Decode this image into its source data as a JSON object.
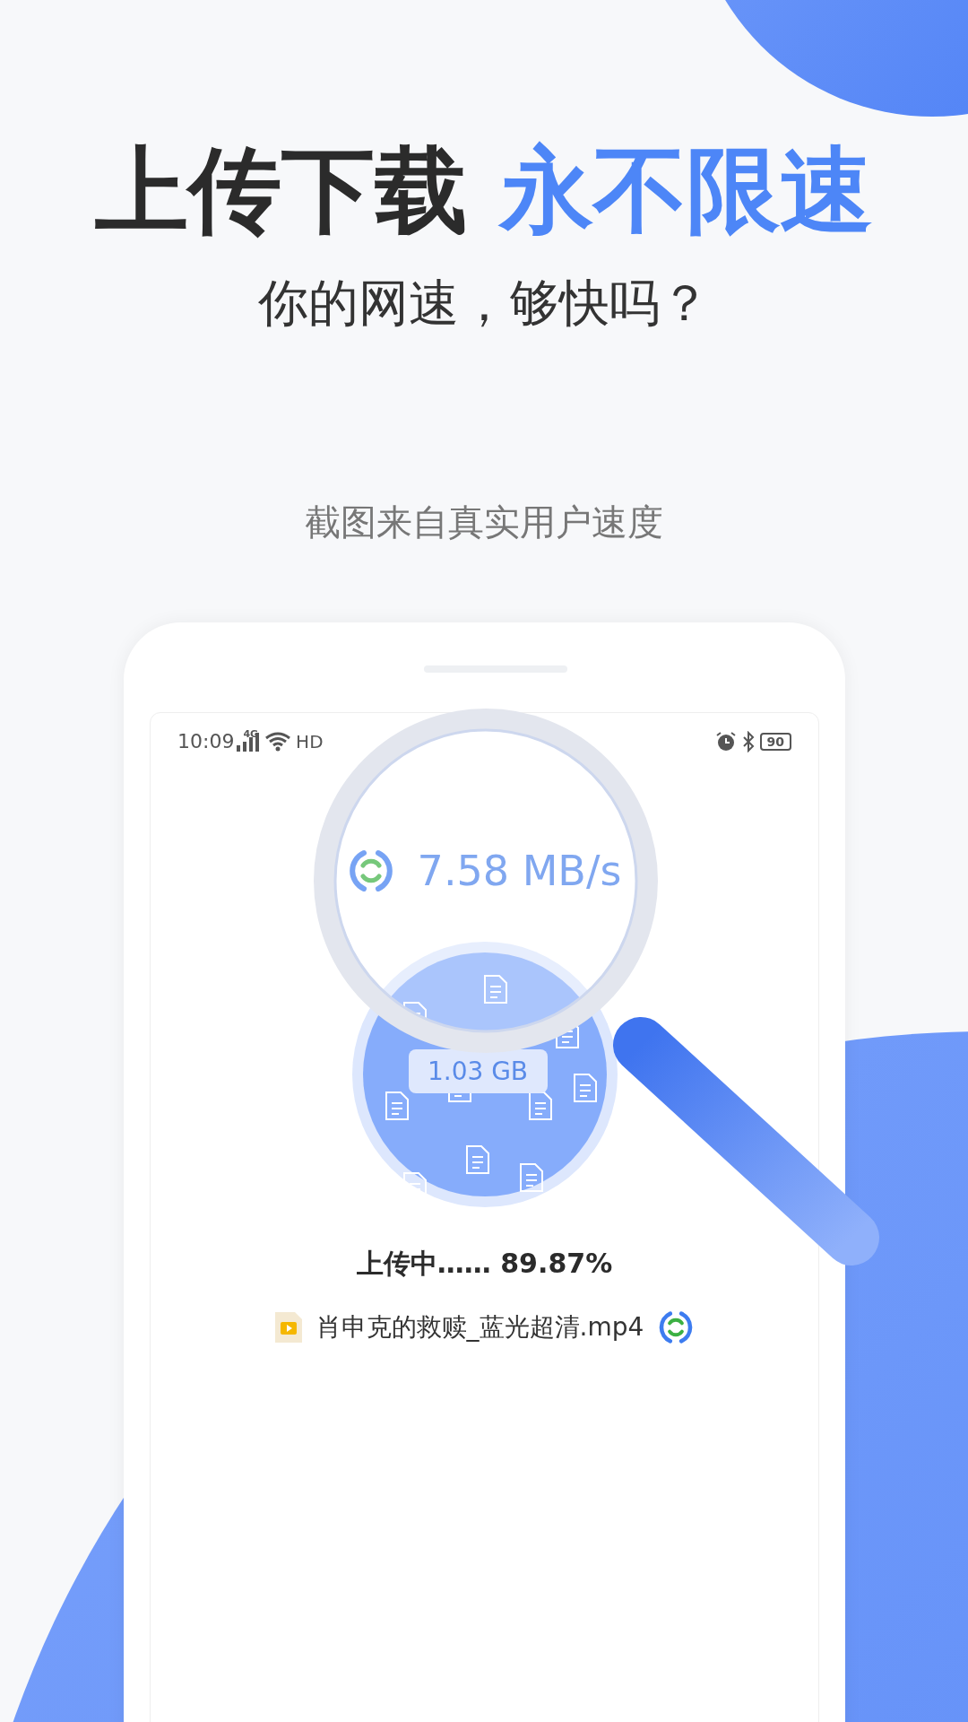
{
  "headline": {
    "dark": "上传下载",
    "accent": "永不限速"
  },
  "subtitle": "你的网速，够快吗？",
  "caption": "截图来自真实用户速度",
  "phone": {
    "status_bar": {
      "time": "10:09",
      "network": "4G",
      "hd": "HD",
      "battery": "90"
    },
    "speed": "7.58 MB/s",
    "size": "1.03 GB",
    "progress_text": "上传中…… 89.87%",
    "file_name": "肖申克的救赎_蓝光超清.mp4"
  }
}
